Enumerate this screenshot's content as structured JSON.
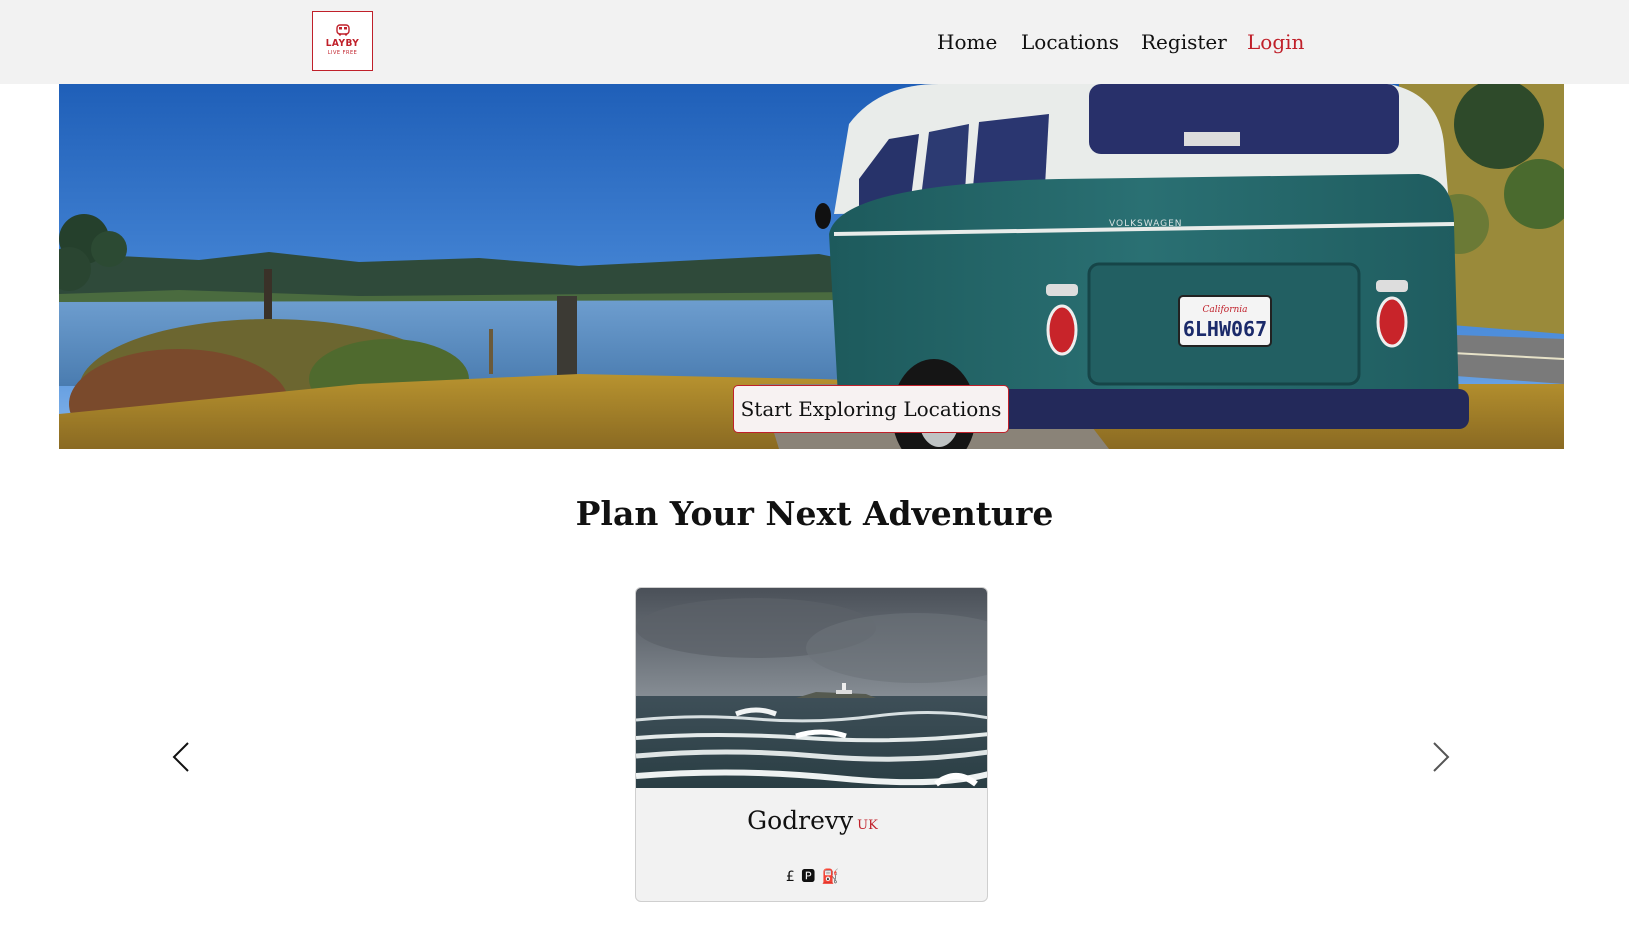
{
  "navbar": {
    "logo": {
      "brand": "LAYBY",
      "tagline": "LIVE FREE"
    },
    "links": [
      {
        "label": "Home"
      },
      {
        "label": "Locations"
      },
      {
        "label": "Register"
      },
      {
        "label": "Login"
      }
    ]
  },
  "hero": {
    "button_label": "Start Exploring Locations",
    "plate_text": "6LHW067",
    "plate_state": "California",
    "vehicle_badge": "VOLKSWAGEN"
  },
  "section": {
    "title": "Plan Your Next Adventure"
  },
  "carousel": {
    "prev_icon": "chevron-left-icon",
    "next_icon": "chevron-right-icon",
    "cards": [
      {
        "name": "Godrevy",
        "country": "UK",
        "amenities": [
          {
            "icon": "pound-icon",
            "glyph": "£"
          },
          {
            "icon": "parking-icon",
            "glyph": "🅿"
          },
          {
            "icon": "fuel-icon",
            "glyph": "⛽"
          }
        ]
      }
    ]
  },
  "colors": {
    "accent": "#c0202a",
    "navbar_bg": "#f2f2f2",
    "card_bg": "#f2f2f2"
  }
}
